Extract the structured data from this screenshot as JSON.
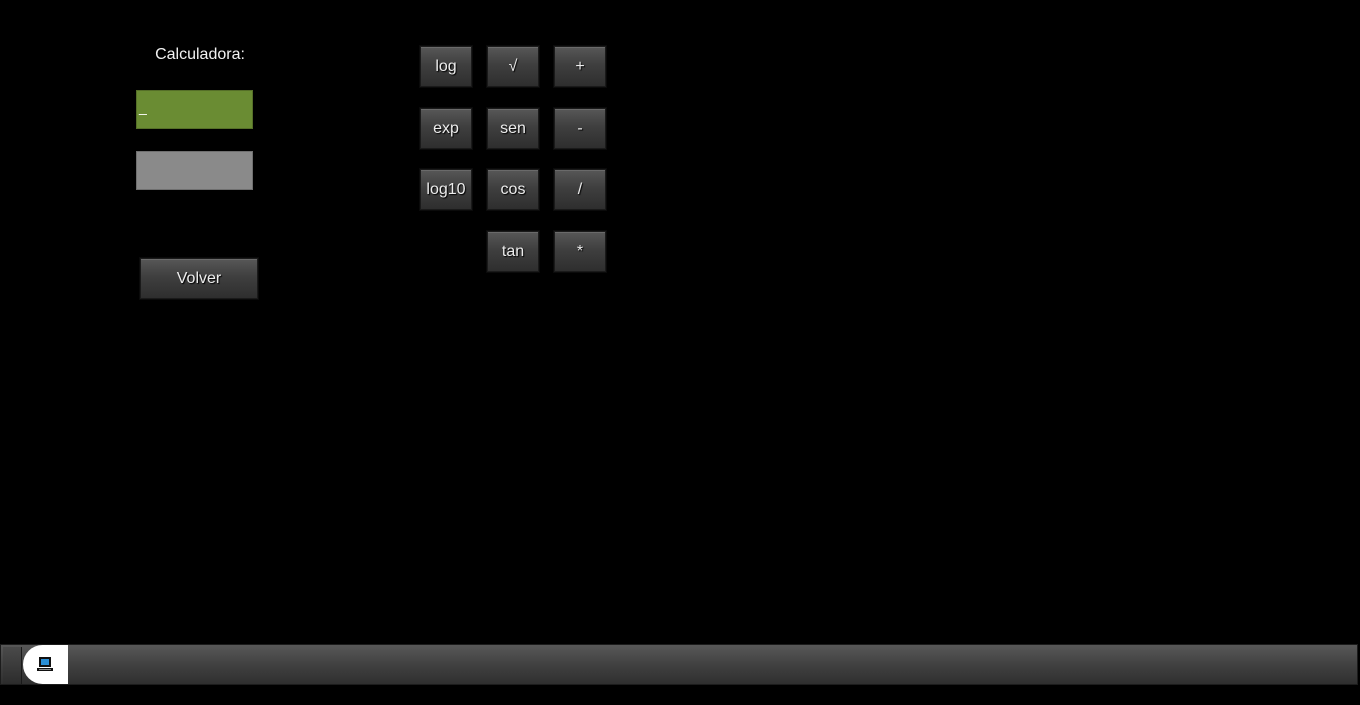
{
  "calculator": {
    "title": "Calculadora:",
    "input_value": "_",
    "output_value": ""
  },
  "buttons": {
    "log": "log",
    "sqrt": "√",
    "plus": "+",
    "exp": "exp",
    "sen": "sen",
    "minus": "-",
    "log10": "log10",
    "cos": "cos",
    "divide": "/",
    "tan": "tan",
    "multiply": "*",
    "back": "Volver"
  },
  "taskbar": {
    "start_icon": "computer-icon"
  },
  "colors": {
    "background": "#000000",
    "input_field": "#6a8c33",
    "output_field": "#8a8a8a",
    "button_face": "#3f3f3f"
  }
}
